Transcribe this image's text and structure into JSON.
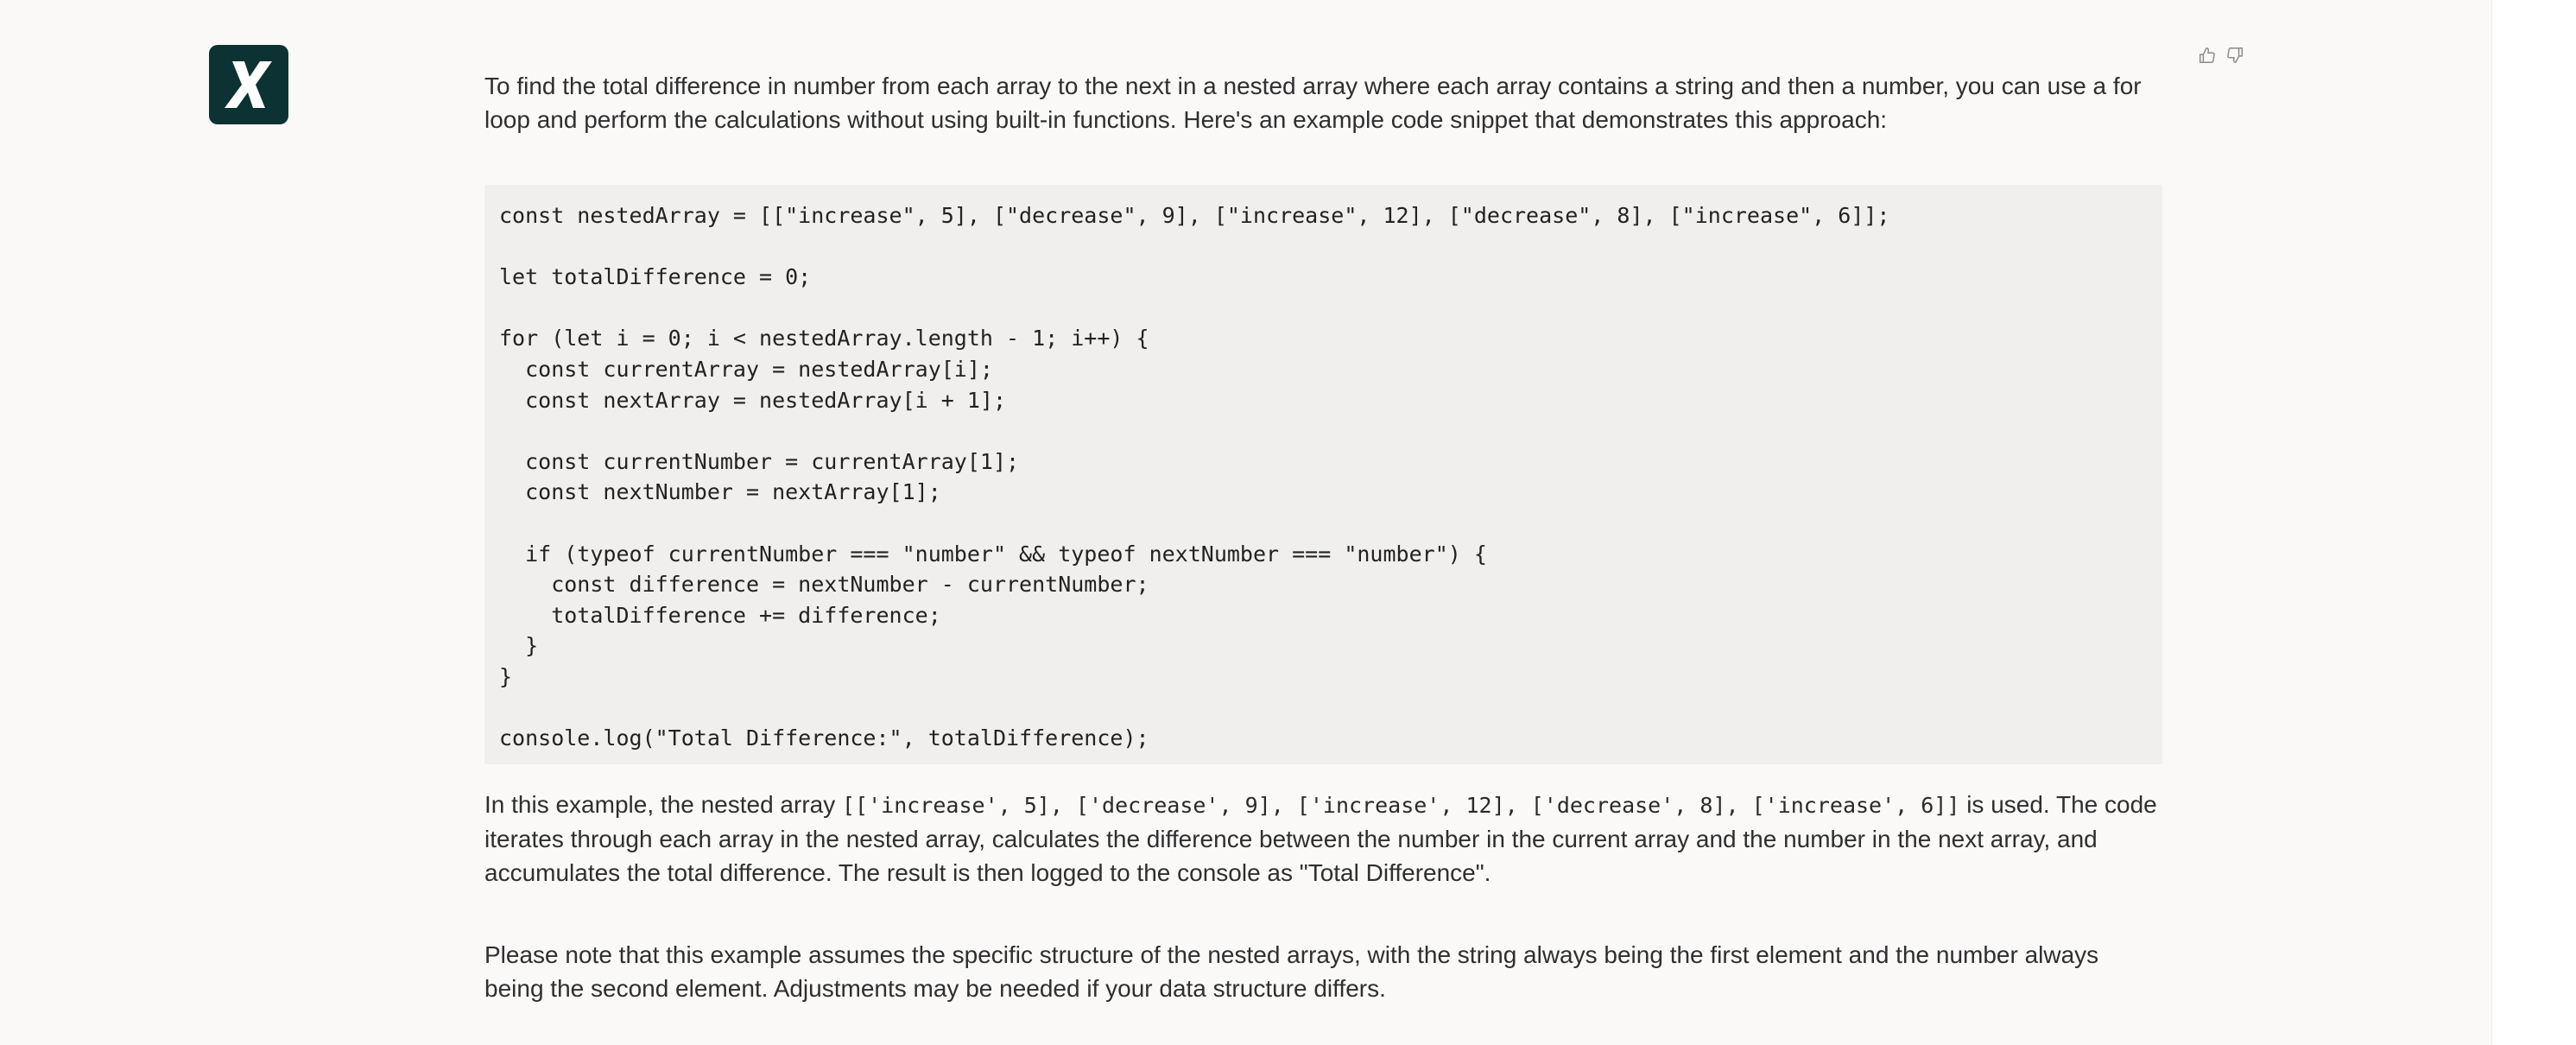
{
  "assistant": {
    "avatar_label": "X",
    "avatar_bg": "#0d3234"
  },
  "feedback": {
    "like_icon": "thumbs-up-icon",
    "dislike_icon": "thumbs-down-icon"
  },
  "message": {
    "intro": "To find the total difference in number from each array to the next in a nested array where each array contains a string and then a number, you can use a for loop and perform the calculations without using built-in functions. Here's an example code snippet that demonstrates this approach:",
    "code": "const nestedArray = [[\"increase\", 5], [\"decrease\", 9], [\"increase\", 12], [\"decrease\", 8], [\"increase\", 6]];\n\nlet totalDifference = 0;\n\nfor (let i = 0; i < nestedArray.length - 1; i++) {\n  const currentArray = nestedArray[i];\n  const nextArray = nestedArray[i + 1];\n\n  const currentNumber = currentArray[1];\n  const nextNumber = nextArray[1];\n\n  if (typeof currentNumber === \"number\" && typeof nextNumber === \"number\") {\n    const difference = nextNumber - currentNumber;\n    totalDifference += difference;\n  }\n}\n\nconsole.log(\"Total Difference:\", totalDifference);",
    "explanation_prefix": "In this example, the nested array ",
    "explanation_code": "[['increase', 5], ['decrease', 9], ['increase', 12], ['decrease', 8], ['increase', 6]]",
    "explanation_suffix": " is used. The code iterates through each array in the nested array, calculates the difference between the number in the current array and the number in the next array, and accumulates the total difference. The result is then logged to the console as \"Total Difference\".",
    "note": "Please note that this example assumes the specific structure of the nested arrays, with the string always being the first element and the number always being the second element. Adjustments may be needed if your data structure differs."
  }
}
